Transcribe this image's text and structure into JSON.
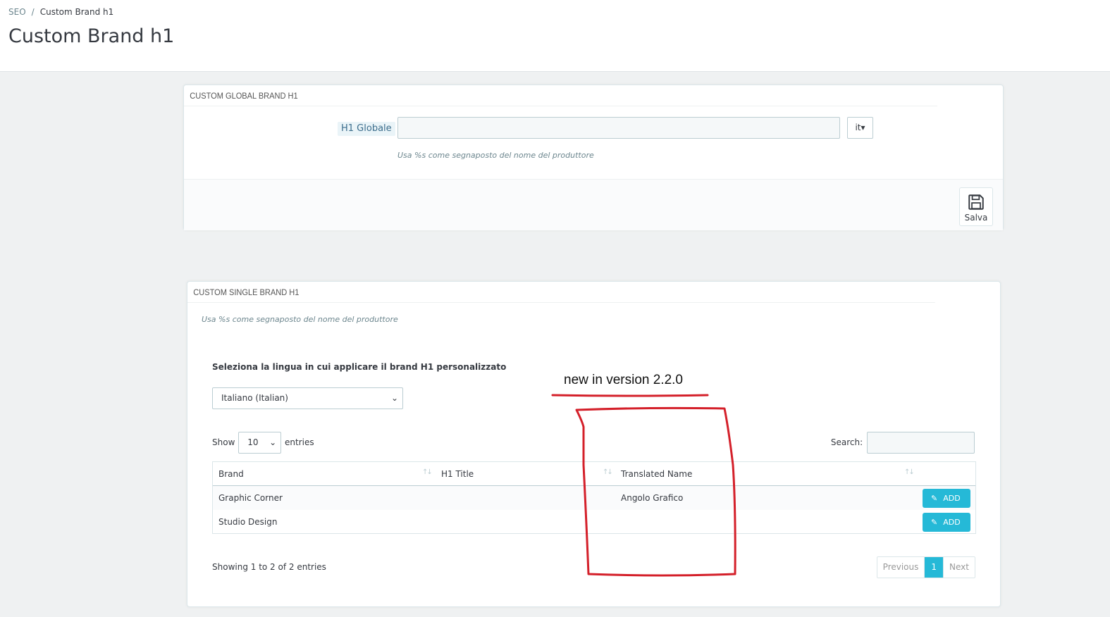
{
  "header": {
    "breadcrumb": [
      "SEO",
      "Custom Brand h1"
    ],
    "title": "Custom Brand h1"
  },
  "global_panel": {
    "heading": "CUSTOM GLOBAL BRAND H1",
    "field_label": "H1 Globale",
    "field_value": "",
    "lang_button": "it",
    "hint": "Usa %s come segnaposto del nome del produttore",
    "save_label": "Salva"
  },
  "single_panel": {
    "heading": "CUSTOM SINGLE BRAND H1",
    "hint": "Usa %s come segnaposto del nome del produttore",
    "select_label": "Seleziona la lingua in cui applicare il brand H1 personalizzato",
    "language_selected": "Italiano (Italian)",
    "show_label": "Show",
    "entries_value": "10",
    "entries_label": "entries",
    "search_label": "Search:",
    "columns": [
      "Brand",
      "H1 Title",
      "Translated Name"
    ],
    "rows": [
      {
        "brand": "Graphic Corner",
        "h1_title": "",
        "translated_name": "Angolo Grafico",
        "action": "ADD"
      },
      {
        "brand": "Studio Design",
        "h1_title": "",
        "translated_name": "",
        "action": "ADD"
      }
    ],
    "showing_text": "Showing 1 to 2 of 2 entries",
    "pagination": {
      "previous": "Previous",
      "current": "1",
      "next": "Next"
    }
  },
  "annotation": {
    "text": "new in version 2.2.0",
    "color": "#d4202a"
  },
  "colors": {
    "accent": "#25b9d7",
    "background": "#eff1f2"
  }
}
